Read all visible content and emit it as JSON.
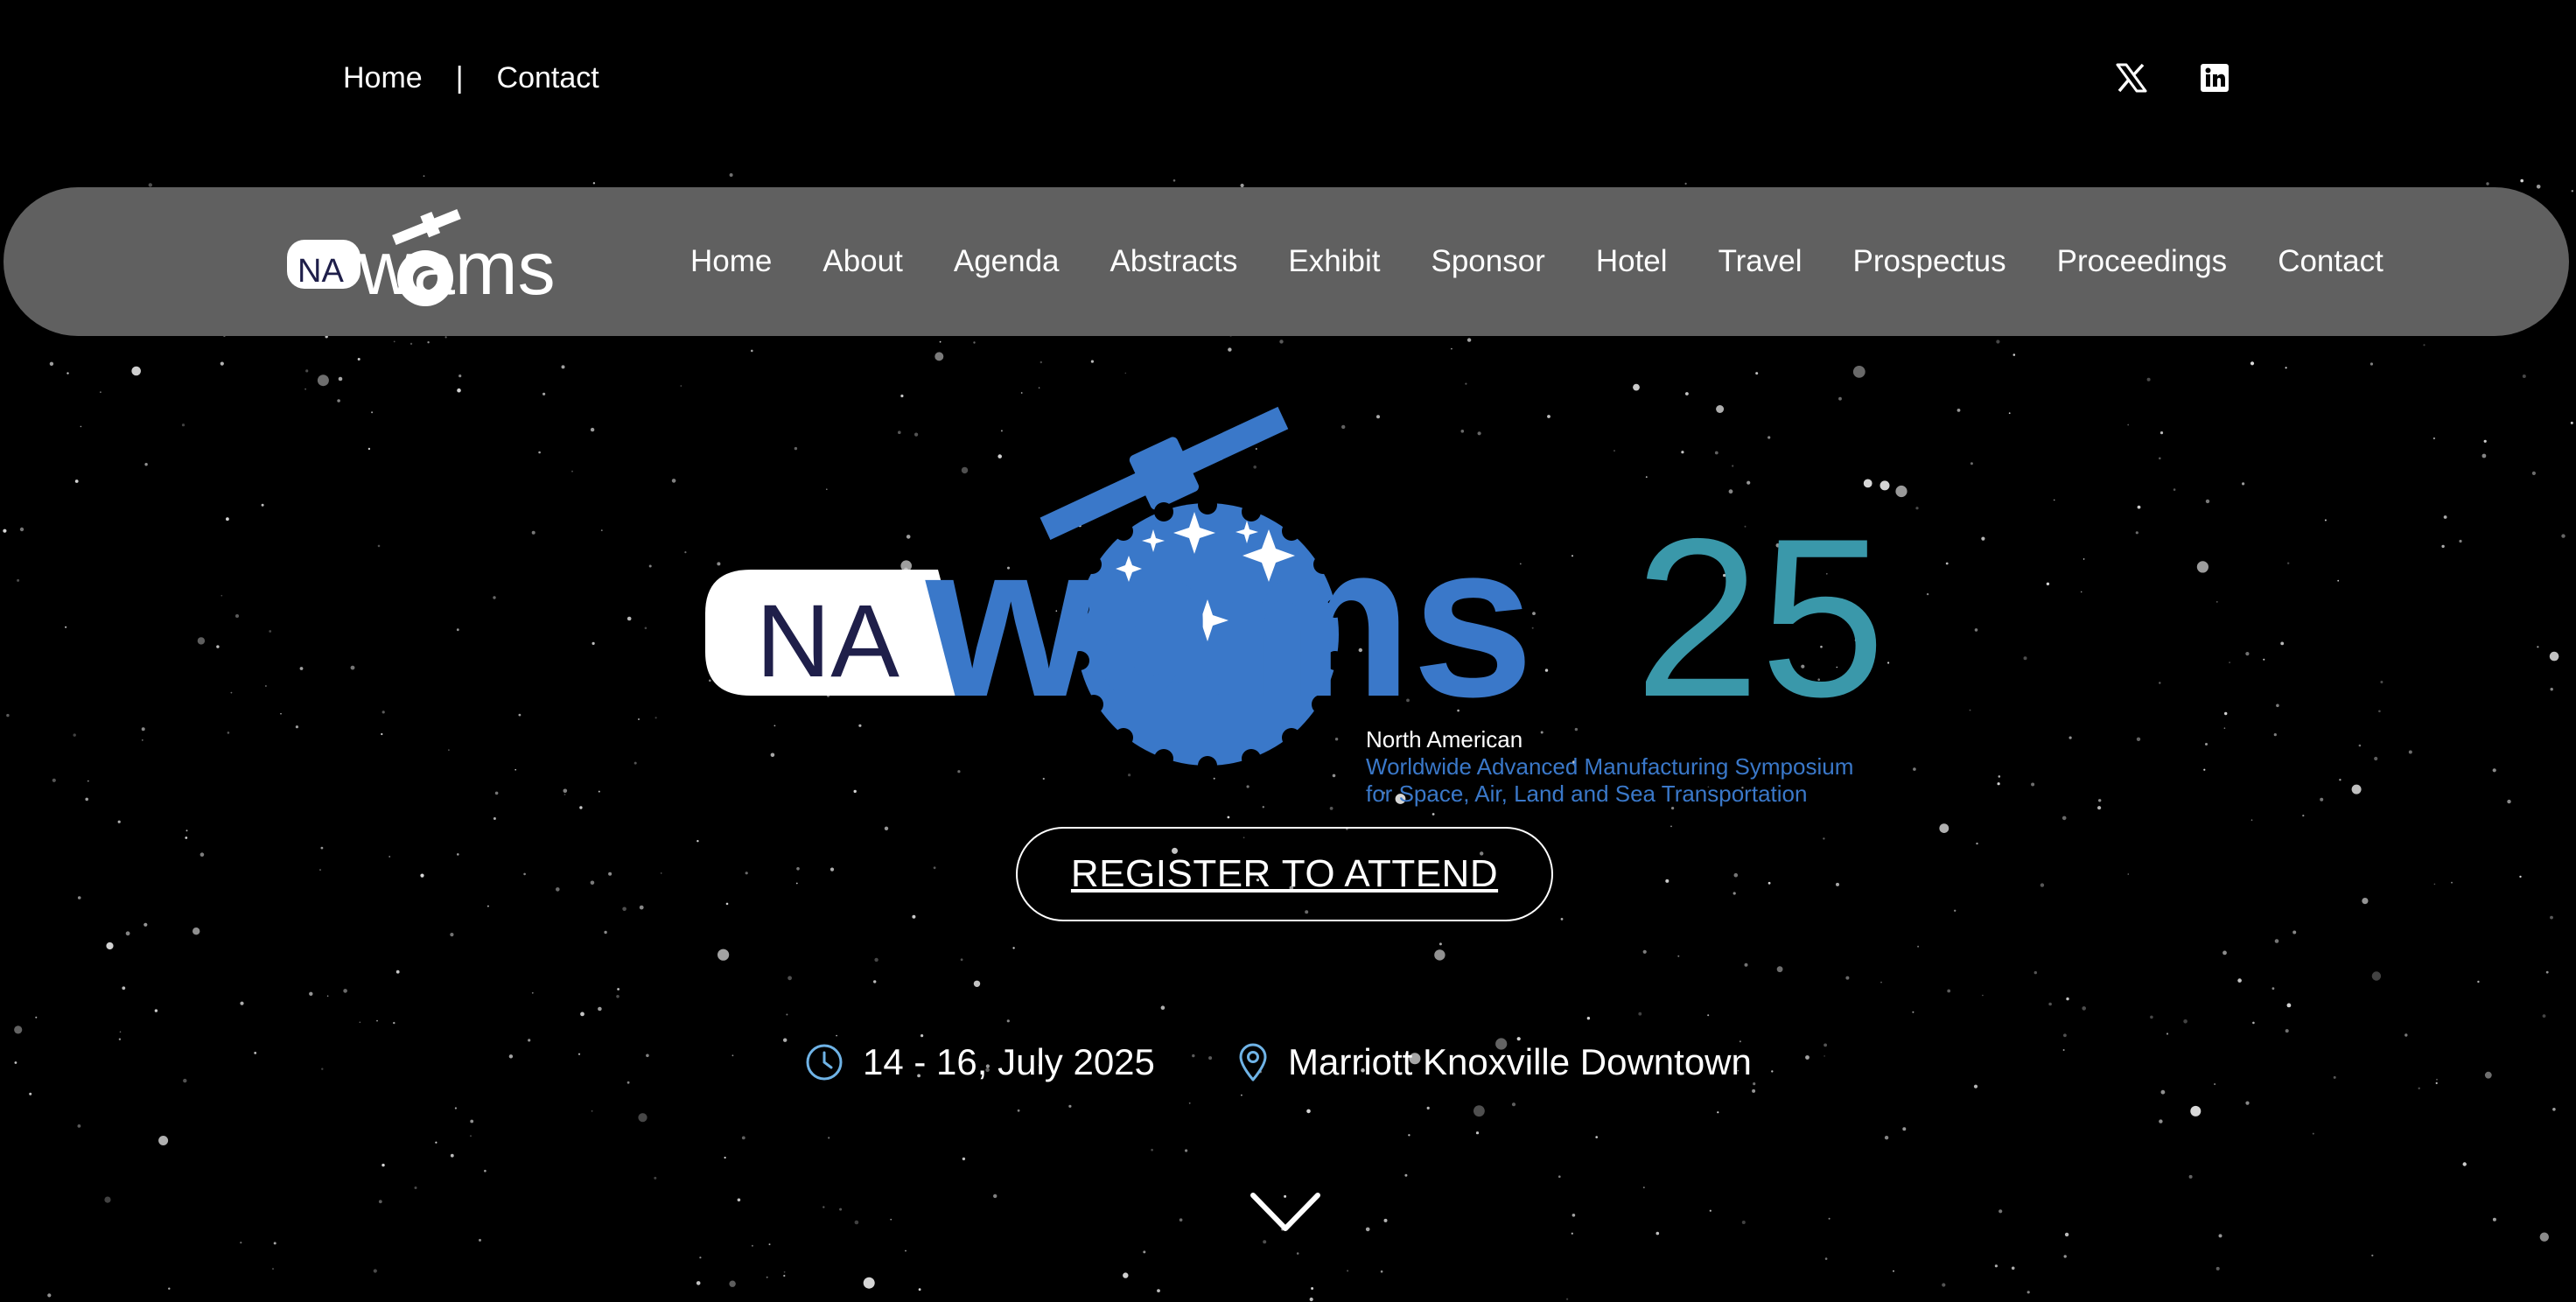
{
  "top_nav": {
    "home": "Home",
    "separator": "|",
    "contact": "Contact"
  },
  "social": {
    "x_icon": "x-logo-icon",
    "linkedin_icon": "linkedin-icon"
  },
  "logo": {
    "prefix": "NA",
    "word": "wams",
    "year": "25"
  },
  "main_nav": [
    "Home",
    "About",
    "Agenda",
    "Abstracts",
    "Exhibit",
    "Sponsor",
    "Hotel",
    "Travel",
    "Prospectus",
    "Proceedings",
    "Contact"
  ],
  "tagline": {
    "line1": "North American",
    "line2": "Worldwide Advanced Manufacturing Symposium",
    "line3": "for Space, Air, Land and Sea Transportation"
  },
  "register_label": "REGISTER TO ATTEND",
  "event": {
    "date": "14 - 16,  July 2025",
    "venue": "Marriott Knoxville Downtown"
  },
  "colors": {
    "nav_bg": "#606060",
    "brand_blue": "#3a78c9",
    "brand_teal": "#3a98aa",
    "accent_icon": "#6fb3e6",
    "na_text": "#1f1f4a"
  }
}
